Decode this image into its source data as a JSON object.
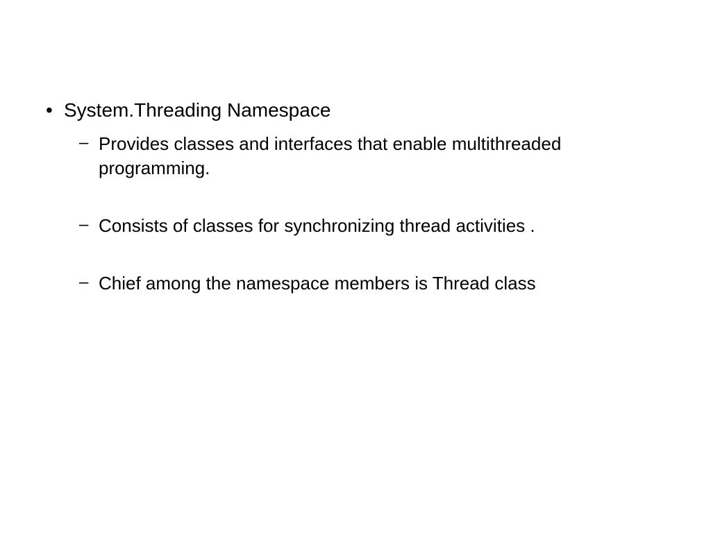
{
  "bullets": {
    "main": "System.Threading Namespace",
    "sub": [
      "Provides classes and interfaces that enable multithreaded programming.",
      "Consists of classes for synchronizing thread activities .",
      "Chief among the namespace members  is Thread class"
    ]
  }
}
